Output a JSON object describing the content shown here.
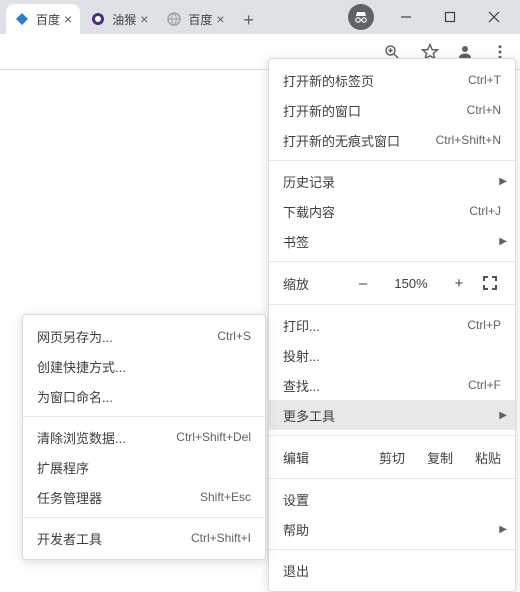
{
  "tabs": [
    {
      "title": "百度",
      "favicon_color": "#2b7cd3"
    },
    {
      "title": "油猴",
      "favicon_color": "#4b2e83"
    },
    {
      "title": "百度",
      "favicon_color": "#9aa0a6"
    }
  ],
  "newtab_label": "+",
  "window_buttons": {
    "min": "–",
    "max": "▢",
    "close": "✕"
  },
  "toolbar": {
    "zoom_icon": "zoom",
    "star_icon": "star",
    "avatar_icon": "avatar",
    "menu_icon": "menu"
  },
  "menu": {
    "new_tab": {
      "label": "打开新的标签页",
      "shortcut": "Ctrl+T"
    },
    "new_window": {
      "label": "打开新的窗口",
      "shortcut": "Ctrl+N"
    },
    "new_incognito": {
      "label": "打开新的无痕式窗口",
      "shortcut": "Ctrl+Shift+N"
    },
    "history": {
      "label": "历史记录"
    },
    "downloads": {
      "label": "下载内容",
      "shortcut": "Ctrl+J"
    },
    "bookmarks": {
      "label": "书签"
    },
    "zoom": {
      "label": "缩放",
      "minus": "–",
      "value": "150%",
      "plus": "+"
    },
    "print": {
      "label": "打印...",
      "shortcut": "Ctrl+P"
    },
    "cast": {
      "label": "投射..."
    },
    "find": {
      "label": "查找...",
      "shortcut": "Ctrl+F"
    },
    "more_tools": {
      "label": "更多工具"
    },
    "edit": {
      "label": "编辑",
      "cut": "剪切",
      "copy": "复制",
      "paste": "粘贴"
    },
    "settings": {
      "label": "设置"
    },
    "help": {
      "label": "帮助"
    },
    "exit": {
      "label": "退出"
    }
  },
  "submenu": {
    "save_as": {
      "label": "网页另存为...",
      "shortcut": "Ctrl+S"
    },
    "create_shortcut": {
      "label": "创建快捷方式..."
    },
    "name_window": {
      "label": "为窗口命名..."
    },
    "clear_data": {
      "label": "清除浏览数据...",
      "shortcut": "Ctrl+Shift+Del"
    },
    "extensions": {
      "label": "扩展程序"
    },
    "task_manager": {
      "label": "任务管理器",
      "shortcut": "Shift+Esc"
    },
    "dev_tools": {
      "label": "开发者工具",
      "shortcut": "Ctrl+Shift+I"
    }
  }
}
